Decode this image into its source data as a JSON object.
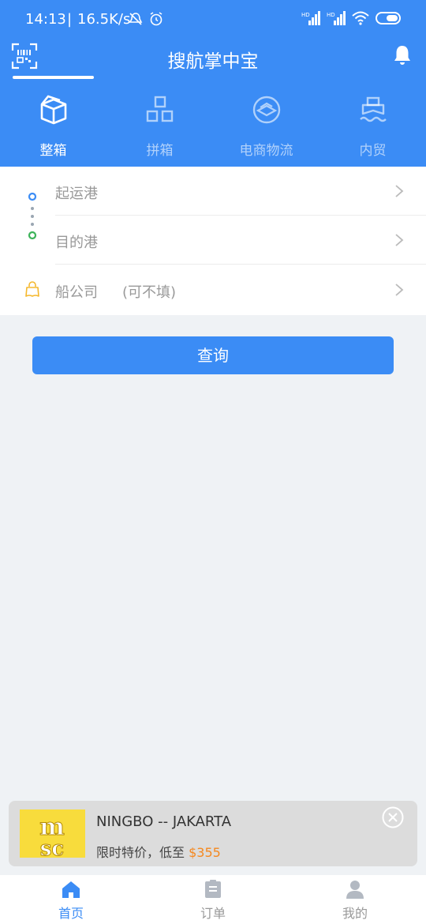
{
  "status_bar": {
    "time": "14:13",
    "separator": "|",
    "speed": "16.5K/s"
  },
  "header": {
    "title": "搜航掌中宝"
  },
  "tabs": [
    {
      "label": "整箱",
      "icon": "box-icon",
      "active": true
    },
    {
      "label": "拼箱",
      "icon": "grid-icon",
      "active": false
    },
    {
      "label": "电商物流",
      "icon": "ecommerce-icon",
      "active": false
    },
    {
      "label": "内贸",
      "icon": "ship-icon",
      "active": false
    }
  ],
  "form": {
    "origin_port": {
      "label": "起运港"
    },
    "destination_port": {
      "label": "目的港"
    },
    "carrier": {
      "label": "船公司",
      "hint": "(可不填)"
    }
  },
  "query_button": {
    "label": "查询"
  },
  "promo": {
    "logo_text": "msc",
    "route": "NINGBO -- JAKARTA",
    "desc": "限时特价，低至 ",
    "price": "$355"
  },
  "bottom_nav": [
    {
      "label": "首页",
      "icon": "home-icon",
      "active": true
    },
    {
      "label": "订单",
      "icon": "orders-icon",
      "active": false
    },
    {
      "label": "我的",
      "icon": "profile-icon",
      "active": false
    }
  ],
  "colors": {
    "primary": "#3b8cf5",
    "price": "#f5881f",
    "background": "#eff2f5"
  }
}
